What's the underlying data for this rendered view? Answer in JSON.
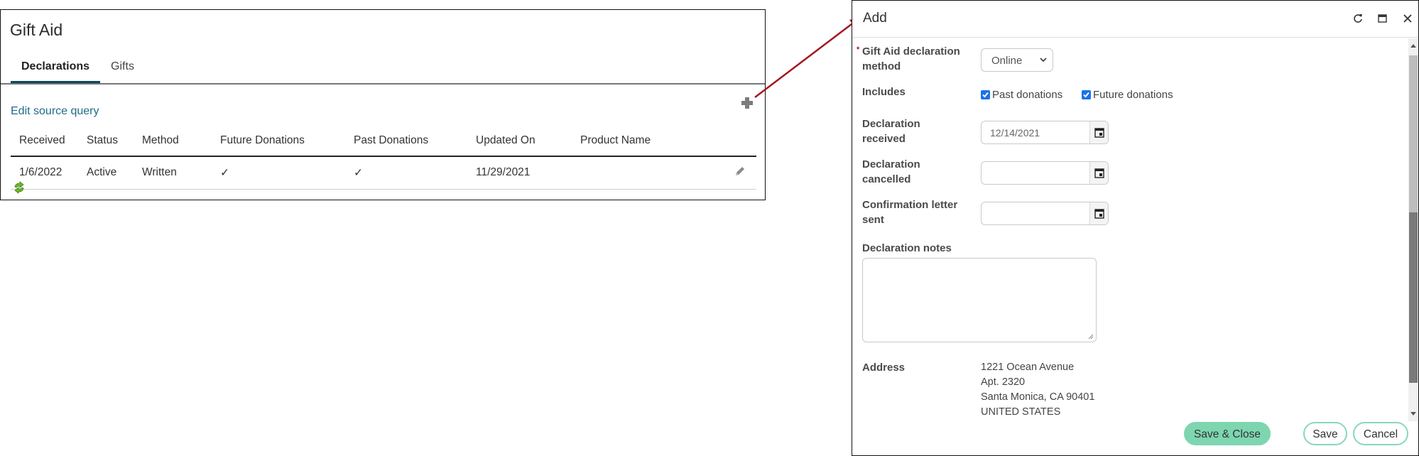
{
  "gift_aid_panel": {
    "title": "Gift Aid",
    "tabs": [
      {
        "label": "Declarations",
        "active": true
      },
      {
        "label": "Gifts",
        "active": false
      }
    ],
    "edit_source_query_label": "Edit source query",
    "add_icon": "plus-icon",
    "table": {
      "columns": [
        "Received",
        "Status",
        "Method",
        "Future Donations",
        "Past Donations",
        "Updated On",
        "Product Name"
      ],
      "rows": [
        {
          "received": "1/6/2022",
          "status": "Active",
          "method": "Written",
          "future_donations": "✓",
          "past_donations": "✓",
          "updated_on": "11/29/2021",
          "product_name": ""
        }
      ]
    },
    "row_action_icon": "pencil-icon",
    "footer_icon": "refresh-icon"
  },
  "annotation": {
    "arrow_color": "#a4161f"
  },
  "add_dialog": {
    "title": "Add",
    "header_controls": [
      "refresh-icon",
      "maximize-icon",
      "close-icon"
    ],
    "fields": {
      "method": {
        "label": "Gift Aid declaration method",
        "required": true,
        "value": "Online"
      },
      "includes": {
        "label": "Includes",
        "options": [
          {
            "label": "Past donations",
            "checked": true
          },
          {
            "label": "Future donations",
            "checked": true
          }
        ]
      },
      "declaration_received": {
        "label": "Declaration received",
        "value": "12/14/2021"
      },
      "declaration_cancelled": {
        "label": "Declaration cancelled",
        "value": ""
      },
      "confirmation_letter_sent": {
        "label": "Confirmation letter sent",
        "value": ""
      },
      "declaration_notes": {
        "label": "Declaration notes",
        "value": ""
      },
      "address": {
        "label": "Address",
        "lines": [
          "1221 Ocean Avenue",
          "Apt. 2320",
          "Santa Monica, CA 90401",
          "UNITED STATES"
        ]
      }
    },
    "buttons": {
      "save_close": "Save & Close",
      "save": "Save",
      "cancel": "Cancel"
    },
    "colors": {
      "primary_button": "#7dd6b0",
      "checkbox": "#1a73e8",
      "required_marker": "#d0021b"
    }
  }
}
